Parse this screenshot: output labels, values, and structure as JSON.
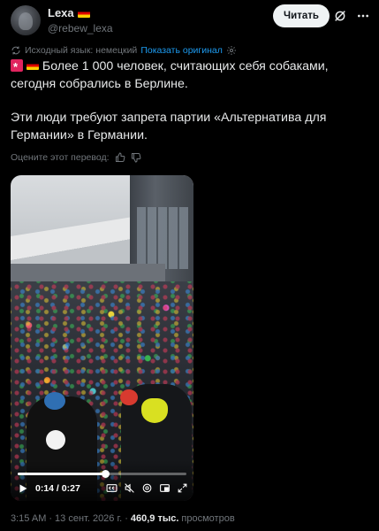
{
  "post": {
    "author": {
      "name": "Lexa",
      "handle": "@rebew_lexa",
      "flag_icon": "germany-flag-icon"
    },
    "read_button_label": "Читать",
    "translation": {
      "source_language_label": "Исходный язык: немецкий",
      "show_original_label": "Показать оригинал"
    },
    "text": {
      "paragraph_1": "Более 1 000 человек, считающих себя собаками, сегодня собрались в Берлине.",
      "paragraph_2": "Эти люди требуют запрета партии «Альтернатива для Германии» в Германии."
    },
    "rate_translation_label": "Оцените этот перевод:",
    "video": {
      "elapsed": "0:14",
      "duration": "0:27",
      "progress": 0.52
    },
    "meta": {
      "time": "3:15 AM",
      "separator": "·",
      "date": "13 сент. 2026 г.",
      "separator_2": "·",
      "views": "460,9 тыс.",
      "views_label": "просмотров"
    }
  },
  "colors": {
    "background": "#000000",
    "text": "#e7e9ea",
    "muted": "#71767b",
    "link": "#1d9bf0",
    "button": "#eff3f4"
  }
}
